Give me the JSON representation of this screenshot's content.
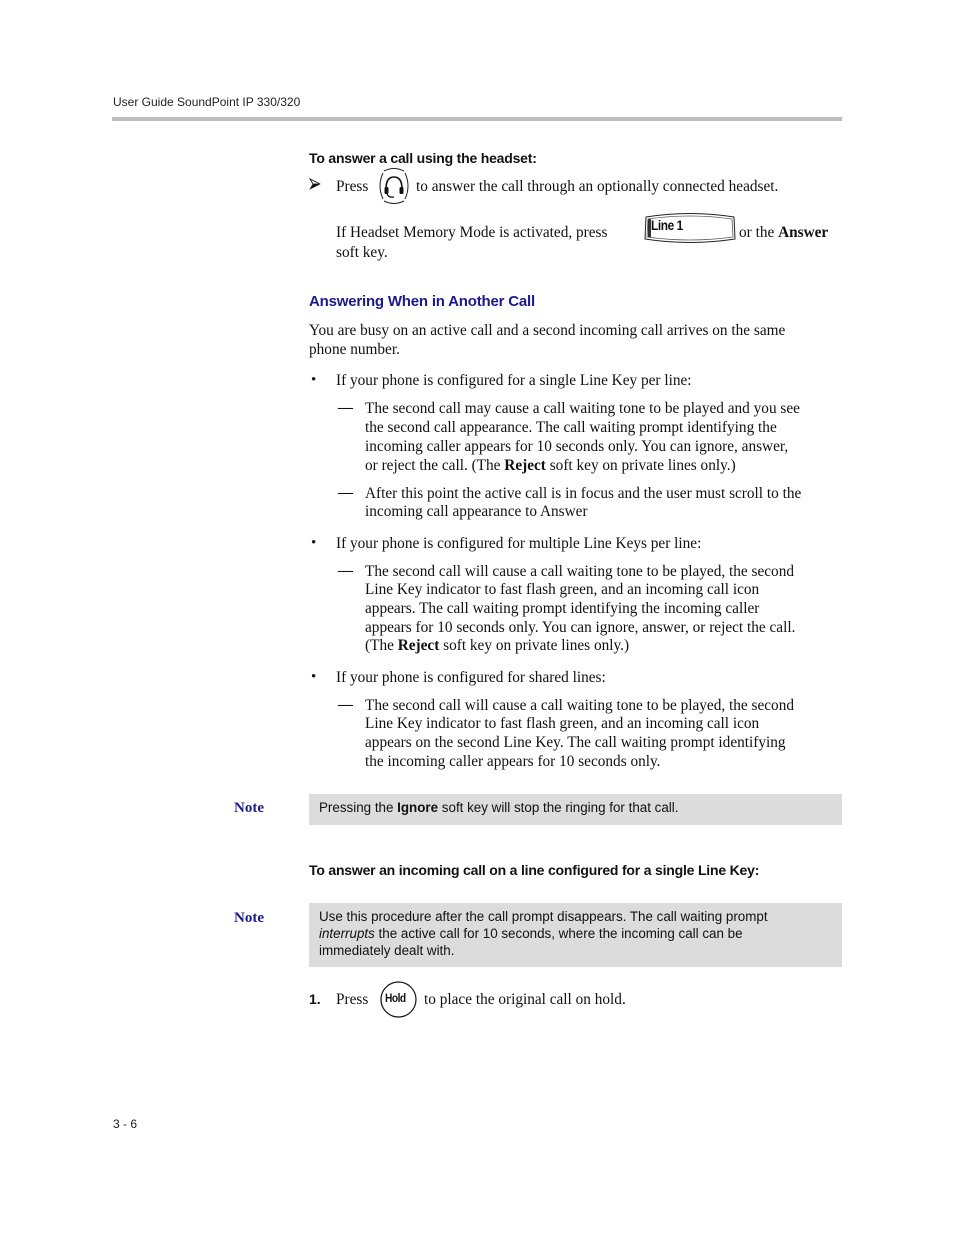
{
  "header": {
    "running_title": "User Guide SoundPoint IP 330/320"
  },
  "headset_procedure": {
    "title": "To answer a call using the headset:",
    "step": {
      "press_word": "Press",
      "key_icon": "headset-key-icon",
      "after_text": "to answer the call through an optionally connected headset."
    },
    "memory_mode": {
      "before_text": "If Headset Memory Mode is activated, press",
      "line_key_label": "Line 1",
      "or_the": "or the",
      "answer_bold": "Answer",
      "soft_key": "soft key."
    }
  },
  "section": {
    "heading": "Answering When in Another Call",
    "intro_line1": "You are busy on an active call and a second incoming call arrives on the same",
    "intro_line2": "phone number."
  },
  "bullets": [
    {
      "text": "If your phone is configured for a single Line Key per line:",
      "subitems": [
        {
          "lines": [
            "The second call may cause a call waiting tone to be played and you see",
            "the second call appearance. The call waiting prompt identifying the",
            "incoming caller appears for 10 seconds only. You can ignore, answer,"
          ],
          "last_pre": "or reject the call. (The ",
          "last_bold": "Reject",
          "last_post": " soft key on private lines only.)"
        },
        {
          "lines": [
            "After this point the active call is in focus and the user must scroll to the",
            "incoming call appearance to Answer"
          ]
        }
      ]
    },
    {
      "text": "If your phone is configured for multiple Line Keys per line:",
      "subitems": [
        {
          "lines": [
            "The second call will cause a call waiting tone to be played, the second",
            "Line Key indicator to fast flash green, and an incoming call icon",
            "appears. The call waiting prompt identifying the incoming caller",
            "appears for 10 seconds only. You can ignore, answer, or reject the call."
          ],
          "last_pre": "(The ",
          "last_bold": "Reject",
          "last_post": " soft key on private lines only.)"
        }
      ]
    },
    {
      "text": "If your phone is configured for shared lines:",
      "subitems": [
        {
          "lines": [
            "The second call will cause a call waiting tone to be played, the second",
            "Line Key indicator to fast flash green, and an incoming call icon",
            "appears on the second Line Key. The call waiting prompt identifying",
            "the incoming caller appears for 10 seconds only."
          ]
        }
      ]
    }
  ],
  "note1": {
    "label": "Note",
    "pre": "Pressing the ",
    "bold": "Ignore",
    "post": " soft key will stop the ringing for that call."
  },
  "single_line_procedure": {
    "title": "To answer an incoming call on a line configured for a single Line Key:"
  },
  "note2": {
    "label": "Note",
    "line1": "Use this procedure after the call prompt disappears. The call waiting prompt",
    "italic": "interrupts",
    "line2_rest": " the active call for 10 seconds, where the incoming call can be",
    "line3": "immediately dealt with."
  },
  "step1": {
    "number": "1.",
    "press_word": "Press",
    "hold_label": "Hold",
    "after_text": "to place the original call on hold."
  },
  "footer": {
    "page_number": "3 - 6"
  },
  "colors": {
    "heading_blue": "#1a1a8c",
    "note_background": "#dcdcdc",
    "header_rule": "#bdbdbd"
  }
}
